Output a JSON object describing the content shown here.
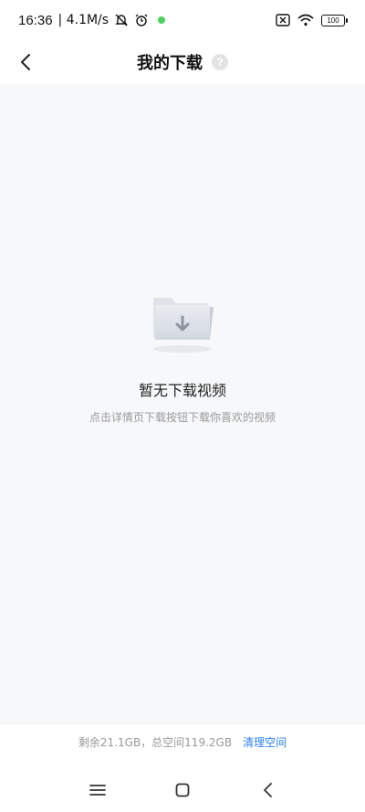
{
  "status_bar": {
    "time": "16:36",
    "speed": "| 4.1M/s",
    "battery": "100",
    "icons": [
      "mute-icon",
      "alarm-icon",
      "green-dot",
      "sim-x-icon",
      "wifi-icon",
      "battery-icon"
    ]
  },
  "header": {
    "title": "我的下载",
    "help": "?"
  },
  "empty_state": {
    "title": "暂无下载视频",
    "subtitle": "点击详情页下载按钮下载你喜欢的视频"
  },
  "storage": {
    "text": "剩余21.1GB，总空间119.2GB",
    "clean_label": "清理空间"
  },
  "colors": {
    "accent": "#2b7ff5",
    "content_bg": "#f7f8fa"
  }
}
